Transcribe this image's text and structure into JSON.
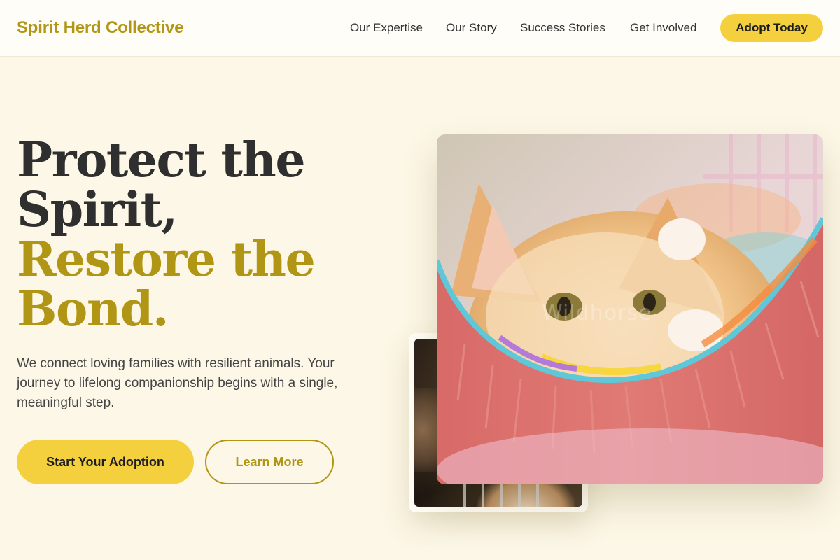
{
  "header": {
    "brand": "Spirit Herd Collective",
    "nav": [
      "Our Expertise",
      "Our Story",
      "Success Stories",
      "Get Involved"
    ],
    "cta": "Adopt Today"
  },
  "hero": {
    "headline_dark": [
      "Protect the",
      "Spirit,"
    ],
    "headline_gold": [
      "Restore the",
      "Bond."
    ],
    "lead": "We connect loving families with resilient animals. Your journey to lifelong companionship begins with a single, meaningful step.",
    "primary_cta": "Start Your Adoption",
    "secondary_cta": "Learn More",
    "main_photo": "kitten-in-hammock-photo",
    "secondary_photo": "puppy-in-kennel-photo",
    "watermark": "Wildhorse"
  },
  "colors": {
    "accent": "#f4d03f",
    "brand_gold": "#b19514",
    "background": "#fcf7e6",
    "text": "#2f2f2f"
  }
}
